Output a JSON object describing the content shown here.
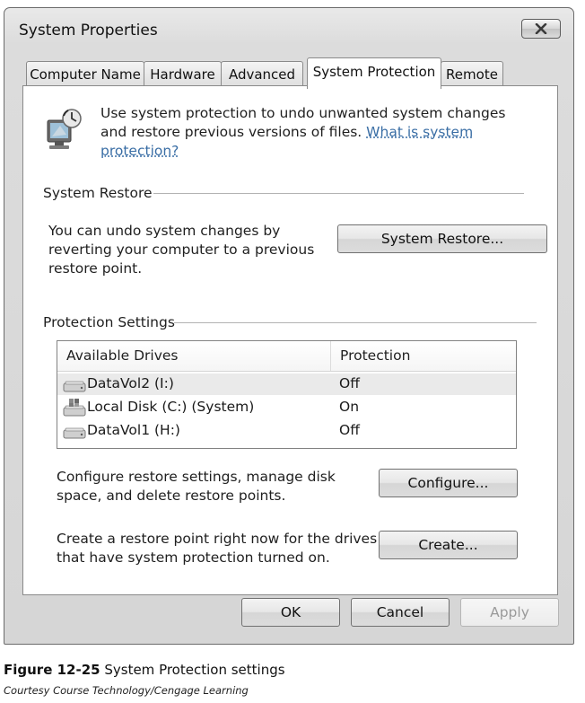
{
  "window": {
    "title": "System Properties"
  },
  "tabs": [
    {
      "label": "Computer Name"
    },
    {
      "label": "Hardware"
    },
    {
      "label": "Advanced"
    },
    {
      "label": "System Protection"
    },
    {
      "label": "Remote"
    }
  ],
  "active_tab": "System Protection",
  "intro": {
    "text": "Use system protection to undo unwanted system changes and restore previous versions of files.",
    "link": "What is system protection?"
  },
  "system_restore": {
    "group_label": "System Restore",
    "description": "You can undo system changes by reverting your computer to a previous restore point.",
    "button": "System Restore..."
  },
  "protection_settings": {
    "group_label": "Protection Settings",
    "columns": {
      "drive": "Available Drives",
      "protection": "Protection"
    },
    "drives": [
      {
        "name": "DataVol2 (I:)",
        "protection": "Off",
        "icon": "hard-drive-icon"
      },
      {
        "name": "Local Disk (C:) (System)",
        "protection": "On",
        "icon": "system-drive-icon"
      },
      {
        "name": "DataVol1 (H:)",
        "protection": "Off",
        "icon": "hard-drive-icon"
      }
    ],
    "configure_text": "Configure restore settings, manage disk space, and delete restore points.",
    "configure_button": "Configure...",
    "create_text": "Create a restore point right now for the drives that have system protection turned on.",
    "create_button": "Create..."
  },
  "footer_buttons": {
    "ok": "OK",
    "cancel": "Cancel",
    "apply": "Apply"
  },
  "caption": {
    "figure_number": "Figure 12-25",
    "figure_title": "System Protection settings",
    "credit": "Courtesy Course Technology/Cengage Learning"
  }
}
